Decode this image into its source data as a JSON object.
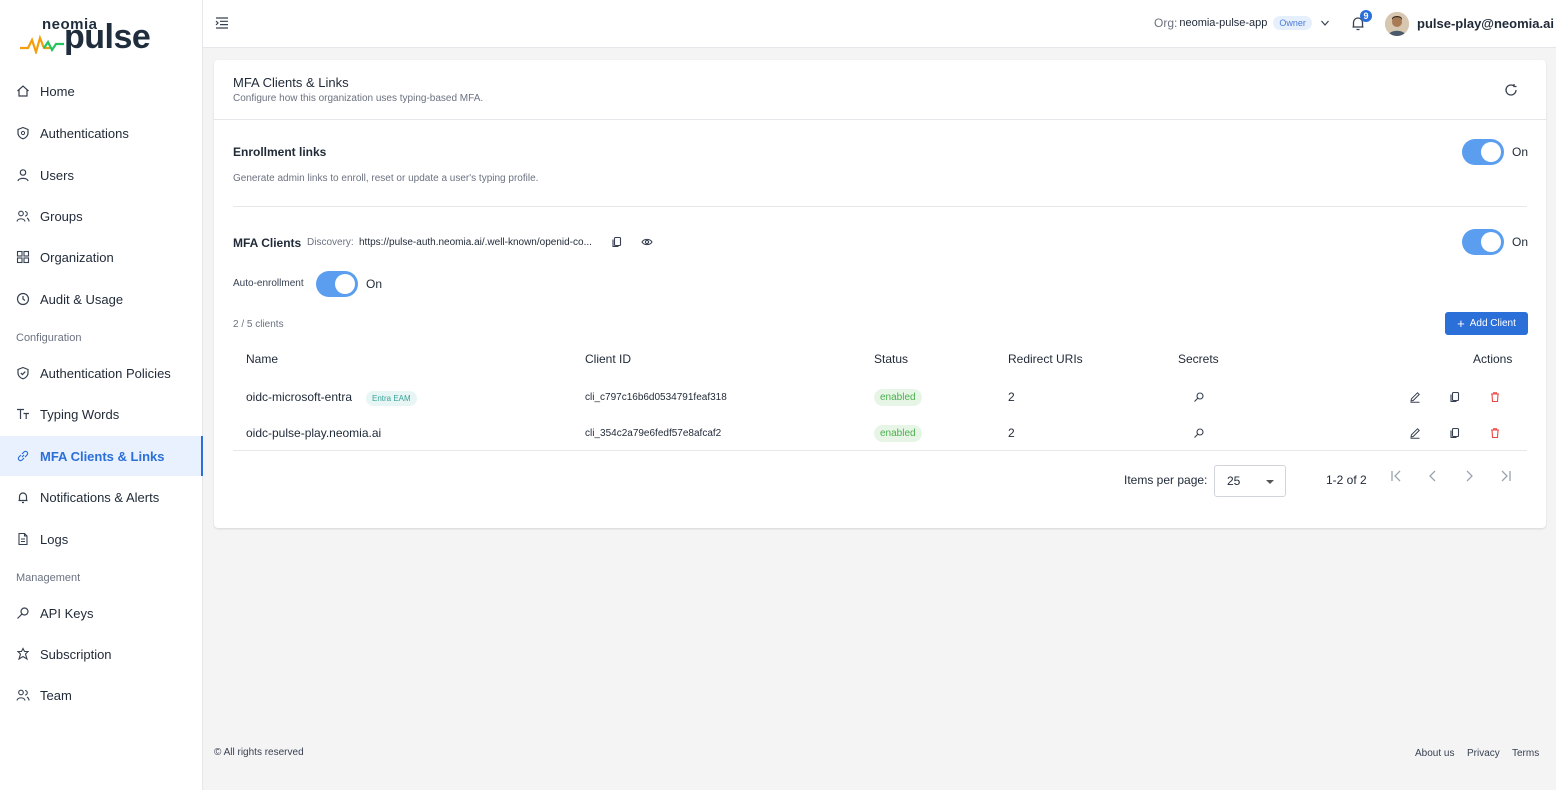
{
  "brand": {
    "small_text": "neomia",
    "big_text": "pulse",
    "accent_color": "#2b6fd8",
    "logo_wave_colors": [
      "#f59e0b",
      "#22c55e"
    ]
  },
  "sidebar": {
    "items": [
      {
        "label": "Home",
        "icon": "home-icon"
      },
      {
        "label": "Authentications",
        "icon": "shield-icon"
      },
      {
        "label": "Users",
        "icon": "user-icon"
      },
      {
        "label": "Groups",
        "icon": "users-icon"
      },
      {
        "label": "Organization",
        "icon": "grid-icon"
      },
      {
        "label": "Audit & Usage",
        "icon": "clock-icon"
      }
    ],
    "section_configuration": "Configuration",
    "config_items": [
      {
        "label": "Authentication Policies",
        "icon": "shield-check-icon"
      },
      {
        "label": "Typing Words",
        "icon": "text-icon"
      },
      {
        "label": "MFA Clients & Links",
        "icon": "link-icon",
        "active": true
      },
      {
        "label": "Notifications & Alerts",
        "icon": "bell-icon"
      },
      {
        "label": "Logs",
        "icon": "document-icon"
      }
    ],
    "section_management": "Management",
    "mgmt_items": [
      {
        "label": "API Keys",
        "icon": "key-icon"
      },
      {
        "label": "Subscription",
        "icon": "badge-icon"
      },
      {
        "label": "Team",
        "icon": "team-icon"
      }
    ]
  },
  "topbar": {
    "org_label": "Org:",
    "org_name": "neomia-pulse-app",
    "role_badge": "Owner",
    "notification_count": "9",
    "user_email": "pulse-play@neomia.ai"
  },
  "card": {
    "title": "MFA Clients & Links",
    "subtitle": "Configure how this organization uses typing-based MFA.",
    "enrollment": {
      "title": "Enrollment links",
      "description": "Generate admin links to enroll, reset or update a user's typing profile.",
      "toggle_label": "On"
    },
    "mfa_clients": {
      "title": "MFA Clients",
      "discovery_label": "Discovery:",
      "discovery_url": "https://pulse-auth.neomia.ai/.well-known/openid-co...",
      "toggle_label": "On",
      "auto_enrollment_label": "Auto-enrollment",
      "auto_enrollment_toggle": "On",
      "count": "2 / 5 clients",
      "add_button": "Add Client"
    },
    "table": {
      "headers": {
        "name": "Name",
        "client_id": "Client ID",
        "status": "Status",
        "redirect_uris": "Redirect URIs",
        "secrets": "Secrets",
        "actions": "Actions"
      },
      "rows": [
        {
          "name": "oidc-microsoft-entra",
          "tag": "Entra EAM",
          "client_id": "cli_c797c16b6d0534791feaf318",
          "status": "enabled",
          "redirect_uris": "2"
        },
        {
          "name": "oidc-pulse-play.neomia.ai",
          "tag": "",
          "client_id": "cli_354c2a79e6fedf57e8afcaf2",
          "status": "enabled",
          "redirect_uris": "2"
        }
      ]
    },
    "paginator": {
      "items_per_page_label": "Items per page:",
      "items_per_page_value": "25",
      "range": "1-2 of 2"
    }
  },
  "footer": {
    "copyright": "© All rights reserved",
    "links": [
      "About us",
      "Privacy",
      "Terms"
    ]
  }
}
